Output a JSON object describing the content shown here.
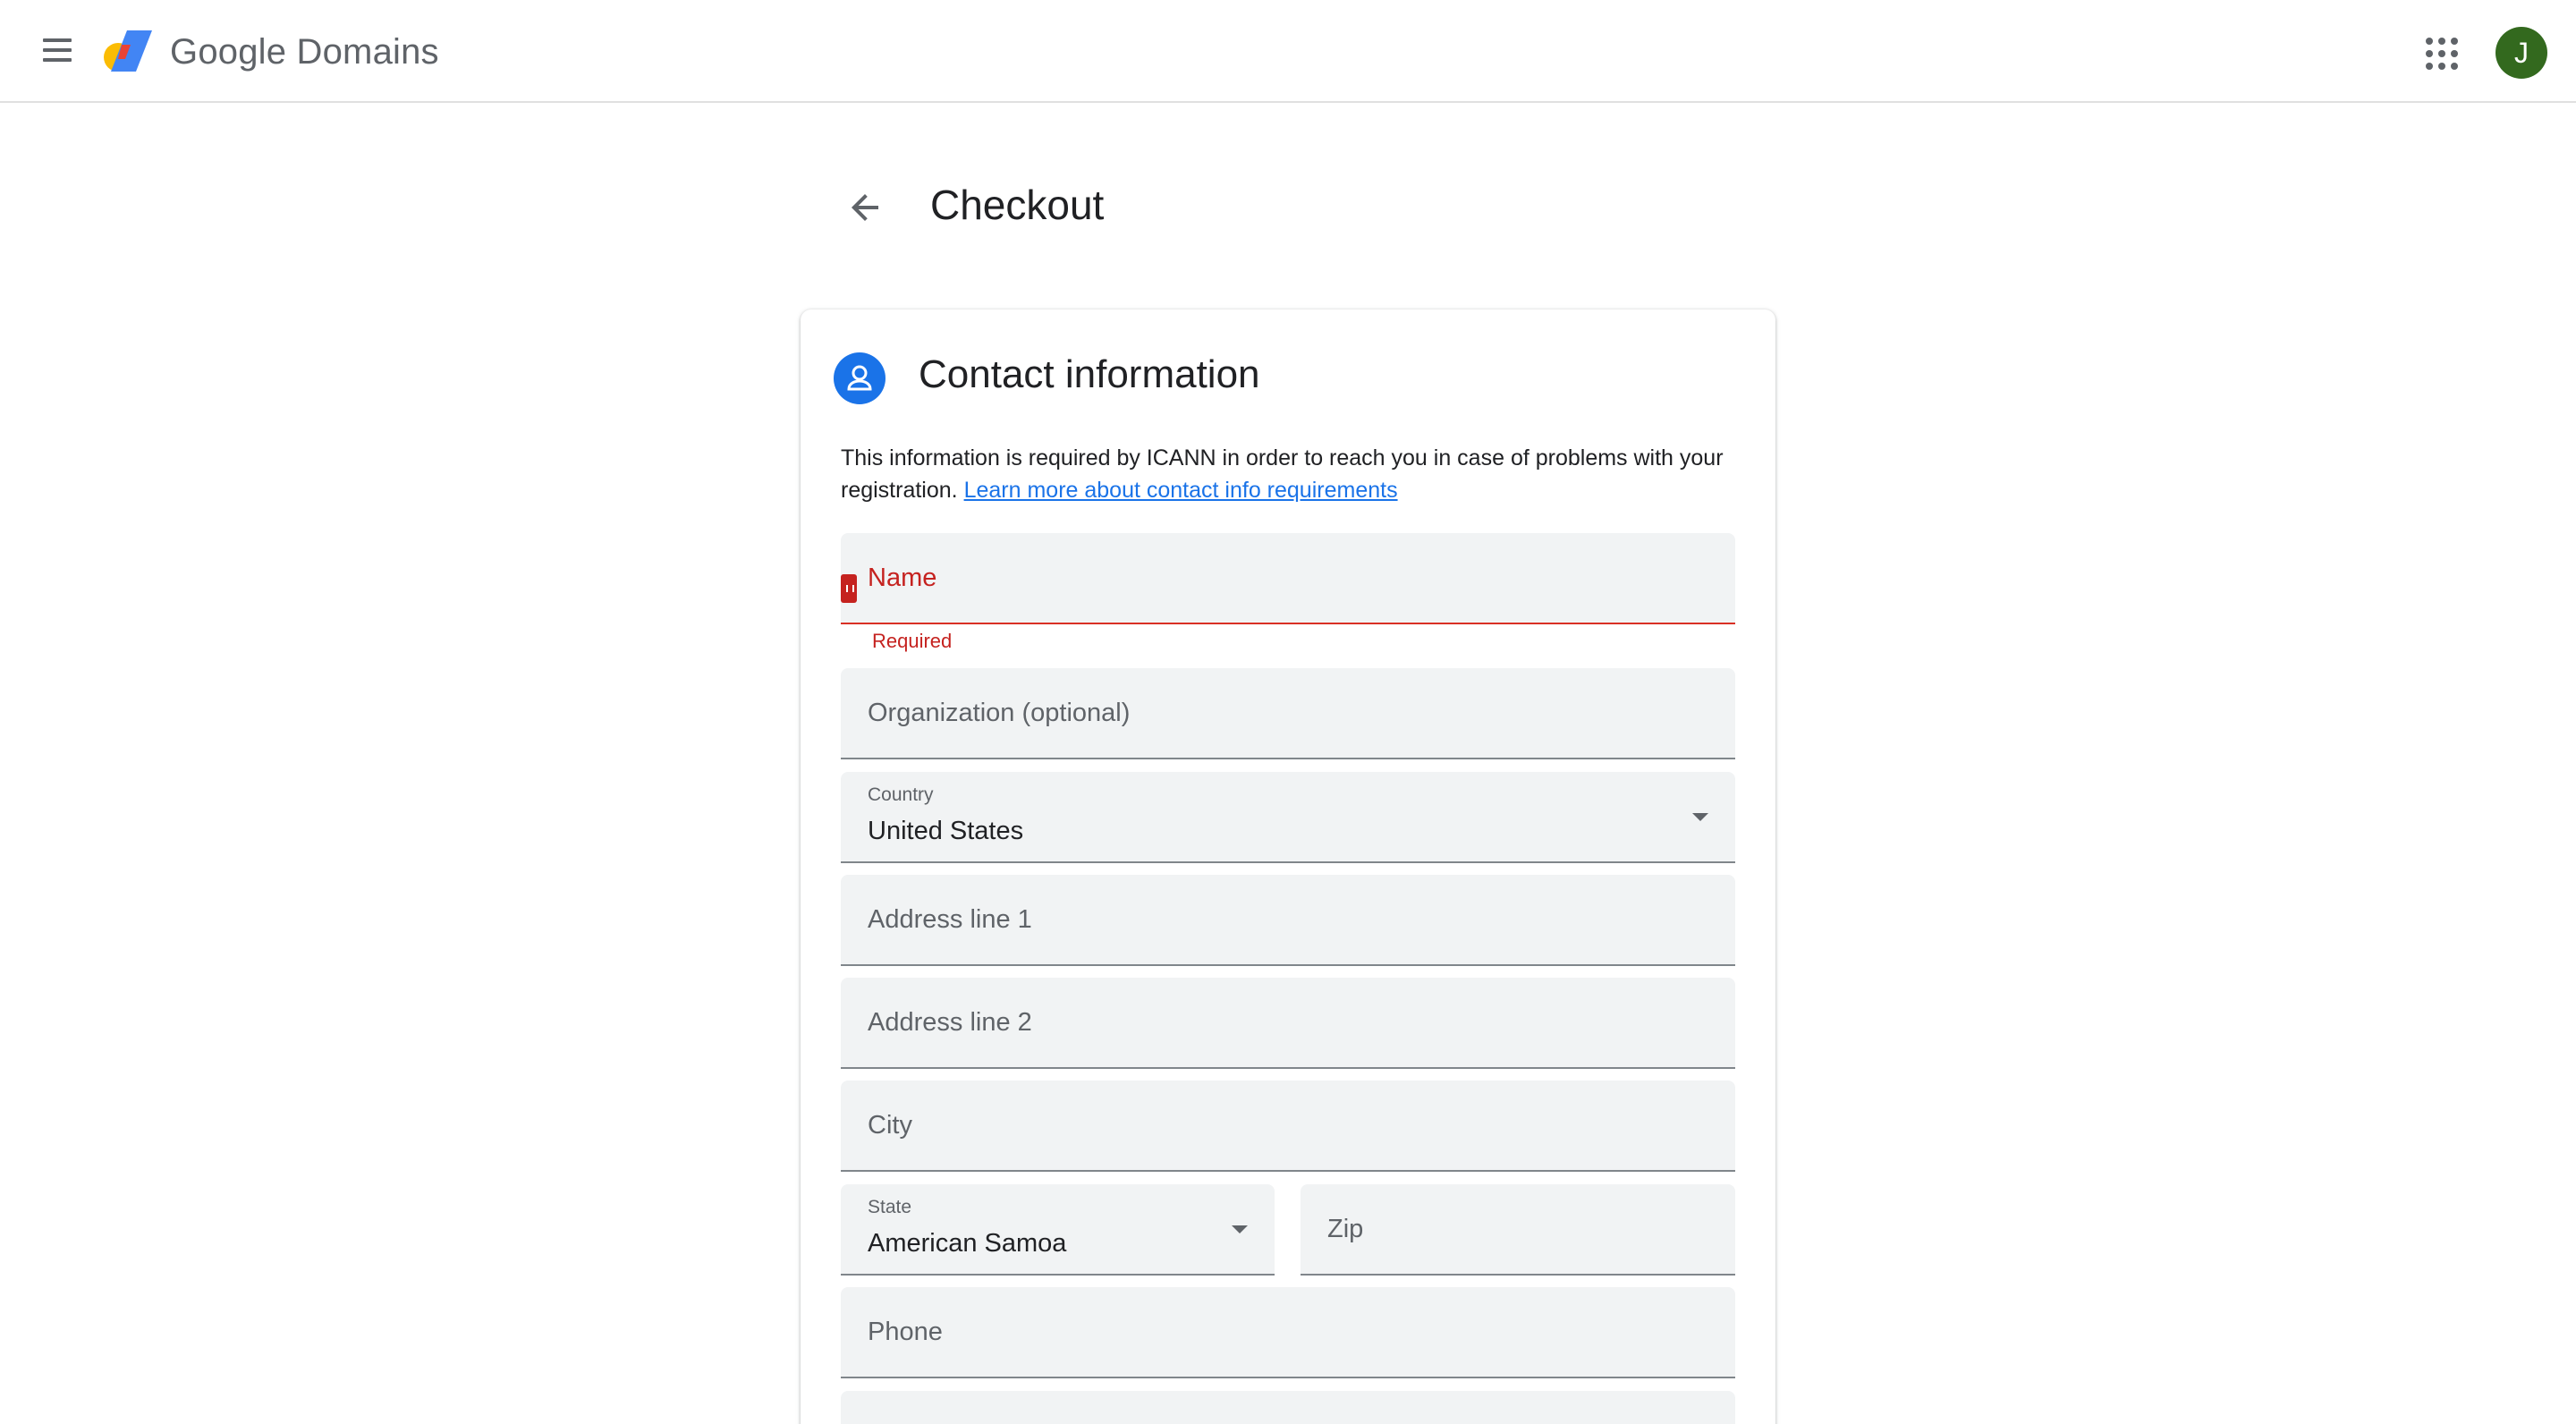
{
  "app": {
    "brand_google": "Google",
    "brand_product": "Domains",
    "avatar_initial": "J"
  },
  "header": {
    "title": "Checkout"
  },
  "section": {
    "title": "Contact information",
    "info_text": "This information is required by ICANN in order to reach you in case of problems with your registration.",
    "info_link": "Learn more about contact info requirements"
  },
  "form": {
    "name": {
      "label": "Name",
      "helper": "Required"
    },
    "organization": {
      "label": "Organization (optional)"
    },
    "country": {
      "label": "Country",
      "value": "United States"
    },
    "address1": {
      "label": "Address line 1"
    },
    "address2": {
      "label": "Address line 2"
    },
    "city": {
      "label": "City"
    },
    "state": {
      "label": "State",
      "value": "American Samoa"
    },
    "zip": {
      "label": "Zip"
    },
    "phone": {
      "label": "Phone"
    }
  },
  "colors": {
    "accent": "#1a73e8",
    "error": "#c5221f",
    "avatar": "#33691e",
    "field_bg": "#f1f3f4"
  },
  "icons": [
    "menu-icon",
    "google-domains-logo",
    "apps-grid-icon",
    "back-arrow-icon",
    "person-icon",
    "dropdown-caret-icon"
  ]
}
